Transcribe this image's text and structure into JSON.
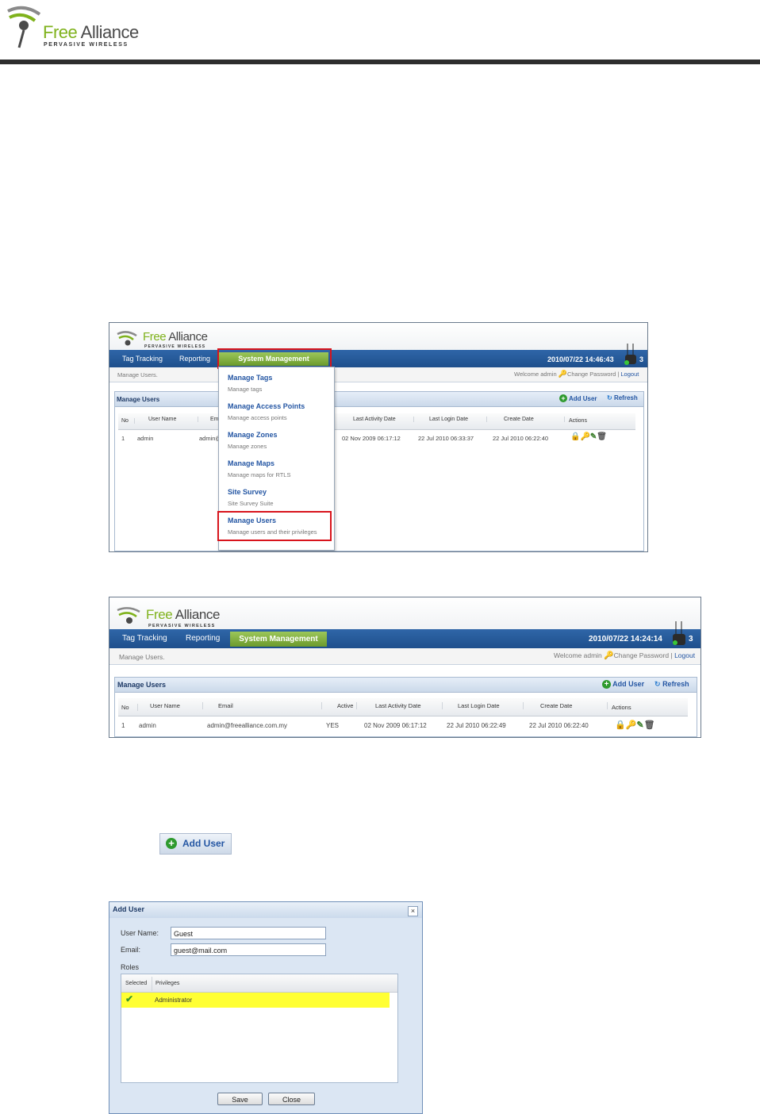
{
  "brand": {
    "name_free": "Free",
    "name_alliance": "Alliance",
    "tagline": "PERVASIVE WIRELESS",
    "color_green": "#7fb21c",
    "color_nav": "#2a5c9c"
  },
  "shot1": {
    "nav": [
      "Tag Tracking",
      "Reporting"
    ],
    "active_tab": "System Management",
    "clock": "2010/07/22 14:46:43",
    "signal_count": "3",
    "breadcrumb": "Manage Users.",
    "welcome": "Welcome admin",
    "change_password": "Change Password",
    "separator": "|",
    "logout": "Logout",
    "panel_title": "Manage Users",
    "add_user": "Add User",
    "refresh": "Refresh",
    "columns": {
      "no": "No",
      "user_name": "User Name",
      "email": "Ema",
      "last_activity": "Last Activity Date",
      "last_login": "Last Login Date",
      "create_date": "Create Date",
      "actions": "Actions"
    },
    "row": {
      "no": "1",
      "user_name": "admin",
      "email": "admin@",
      "last_activity": "02 Nov 2009 06:17:12",
      "last_login": "22 Jul 2010 06:33:37",
      "create_date": "22 Jul 2010 06:22:40"
    },
    "menu": [
      {
        "title": "Manage Tags",
        "desc": "Manage tags"
      },
      {
        "title": "Manage Access Points",
        "desc": "Manage access points"
      },
      {
        "title": "Manage Zones",
        "desc": "Manage zones"
      },
      {
        "title": "Manage Maps",
        "desc": "Manage maps for RTLS"
      },
      {
        "title": "Site Survey",
        "desc": "Site Survey Suite"
      },
      {
        "title": "Manage Users",
        "desc": "Manage users and their privileges"
      }
    ]
  },
  "shot2": {
    "nav": [
      "Tag Tracking",
      "Reporting"
    ],
    "active_tab": "System Management",
    "clock": "2010/07/22 14:24:14",
    "signal_count": "3",
    "breadcrumb": "Manage Users.",
    "welcome": "Welcome admin",
    "change_password": "Change Password",
    "separator": "|",
    "logout": "Logout",
    "panel_title": "Manage Users",
    "add_user": "Add User",
    "refresh": "Refresh",
    "columns": {
      "no": "No",
      "user_name": "User Name",
      "email": "Email",
      "active": "Active",
      "last_activity": "Last Activity Date",
      "last_login": "Last Login Date",
      "create_date": "Create Date",
      "actions": "Actions"
    },
    "row": {
      "no": "1",
      "user_name": "admin",
      "email": "admin@freealliance.com.my",
      "active": "YES",
      "last_activity": "02 Nov 2009 06:17:12",
      "last_login": "22 Jul 2010 06:22:49",
      "create_date": "22 Jul 2010 06:22:40"
    }
  },
  "add_user_button": {
    "label": "Add User"
  },
  "dialog": {
    "title": "Add User",
    "user_name_label": "User Name:",
    "user_name_value": "Guest",
    "email_label": "Email:",
    "email_value": "guest@mail.com",
    "roles_label": "Roles",
    "col_selected": "Selected",
    "col_privileges": "Privileges",
    "role": "Administrator",
    "highlight_color": "#ffff33",
    "save": "Save",
    "close": "Close"
  }
}
